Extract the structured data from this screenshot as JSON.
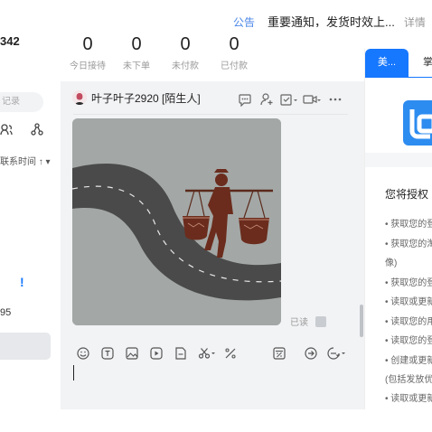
{
  "header": {
    "shop_id": "342",
    "notice_tag": "公告",
    "notice_text": "重要通知，发货时效上...",
    "notice_link": "详情",
    "stats": [
      {
        "value": "0",
        "label": "今日接待"
      },
      {
        "value": "0",
        "label": "未下单"
      },
      {
        "value": "0",
        "label": "未付款"
      },
      {
        "value": "0",
        "label": "已付款"
      }
    ]
  },
  "sidebar": {
    "search_placeholder": "记录",
    "sort_label": "联系时间",
    "alert": "!",
    "count": "95"
  },
  "chat": {
    "user_name": "叶子叶子2920 [陌生人]",
    "read_status": "已读",
    "image_icon": "porter-on-road"
  },
  "right_panel": {
    "tabs": [
      "美...",
      "掌..."
    ],
    "auth_title": "您将授权 美",
    "permissions": [
      "获取您的登",
      "获取您的淘",
      "像)",
      "获取您的登",
      "读取或更新",
      "读取您的用",
      "读取您的登",
      "创建或更新",
      "(包括发放优惠",
      "读取或更新"
    ]
  },
  "colors": {
    "accent": "#1677ff",
    "chat_bg": "#f2f3f5"
  }
}
